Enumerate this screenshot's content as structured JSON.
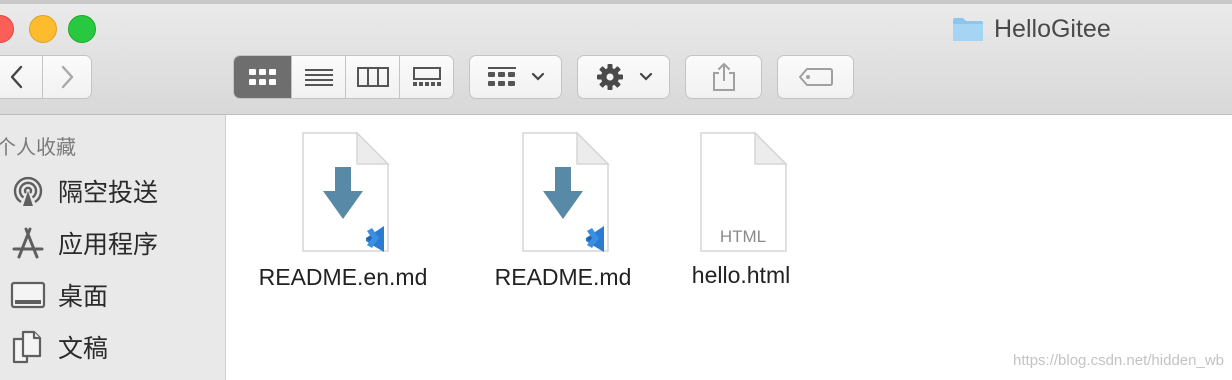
{
  "window": {
    "title": "HelloGitee",
    "folder_icon": "folder-icon"
  },
  "toolbar": {
    "back": "chevron-left-icon",
    "forward": "chevron-right-icon",
    "view_modes": [
      "icon-view",
      "list-view",
      "column-view",
      "gallery-view"
    ],
    "active_view": "icon-view",
    "group_menu": "group-by-icon",
    "action_menu": "gear-icon",
    "share": "share-icon",
    "tags": "tag-icon"
  },
  "sidebar": {
    "heading": "个人收藏",
    "items": [
      {
        "label": "隔空投送",
        "icon": "airdrop-icon"
      },
      {
        "label": "应用程序",
        "icon": "applications-icon"
      },
      {
        "label": "桌面",
        "icon": "desktop-icon"
      },
      {
        "label": "文稿",
        "icon": "documents-icon"
      }
    ]
  },
  "files": [
    {
      "name": "README.en.md",
      "icon": "markdown-vscode-icon"
    },
    {
      "name": "README.md",
      "icon": "markdown-vscode-icon"
    },
    {
      "name": "hello.html",
      "icon": "html-file-icon",
      "badge": "HTML"
    }
  ],
  "watermark": "https://blog.csdn.net/hidden_wb",
  "colors": {
    "arrow": "#588aa8",
    "vscode": "#2b7bd0",
    "sidebar": "#e9e9e9"
  }
}
